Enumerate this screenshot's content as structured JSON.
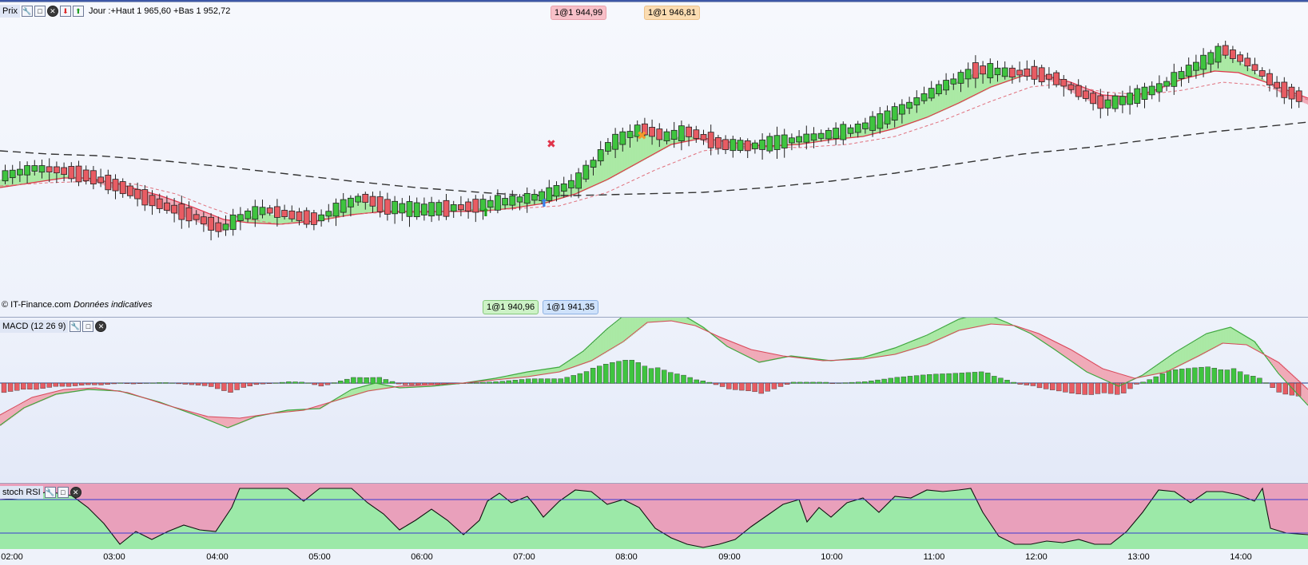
{
  "price_pane": {
    "title": "Prix",
    "daily_info": "Jour :+Haut 1 965,60 +Bas 1 952,72",
    "credit_source": "© IT-Finance.com",
    "credit_note": "Données indicatives",
    "order_tags": {
      "top_red": "1@1 944,99",
      "top_orange": "1@1 946,81",
      "bottom_green": "1@1 940,96",
      "bottom_blue": "1@1 941,35"
    },
    "toolbar_icons": [
      "wrench-icon",
      "window-icon",
      "close-icon",
      "arrow-down-red-icon",
      "arrow-up-green-icon"
    ]
  },
  "macd_pane": {
    "title": "MACD (12 26 9)",
    "toolbar_icons": [
      "wrench-icon",
      "window-icon",
      "close-icon"
    ]
  },
  "rsi_pane": {
    "title": "stoch RSI",
    "toolbar_icons": [
      "wrench-icon",
      "window-icon",
      "close-icon"
    ]
  },
  "x_axis": {
    "ticks": [
      "02:00",
      "03:00",
      "04:00",
      "05:00",
      "06:00",
      "07:00",
      "08:00",
      "09:00",
      "10:00",
      "11:00",
      "12:00",
      "13:00",
      "14:00"
    ]
  },
  "colors": {
    "up_candle": "#3fc43f",
    "down_candle": "#e85c63",
    "green_fill": "#a6e8a0",
    "red_fill": "#f0a7b4",
    "rsi_green": "#9ce9a8",
    "rsi_pink": "#e9a0bb",
    "rsi_band": "#3a3ad0"
  }
}
